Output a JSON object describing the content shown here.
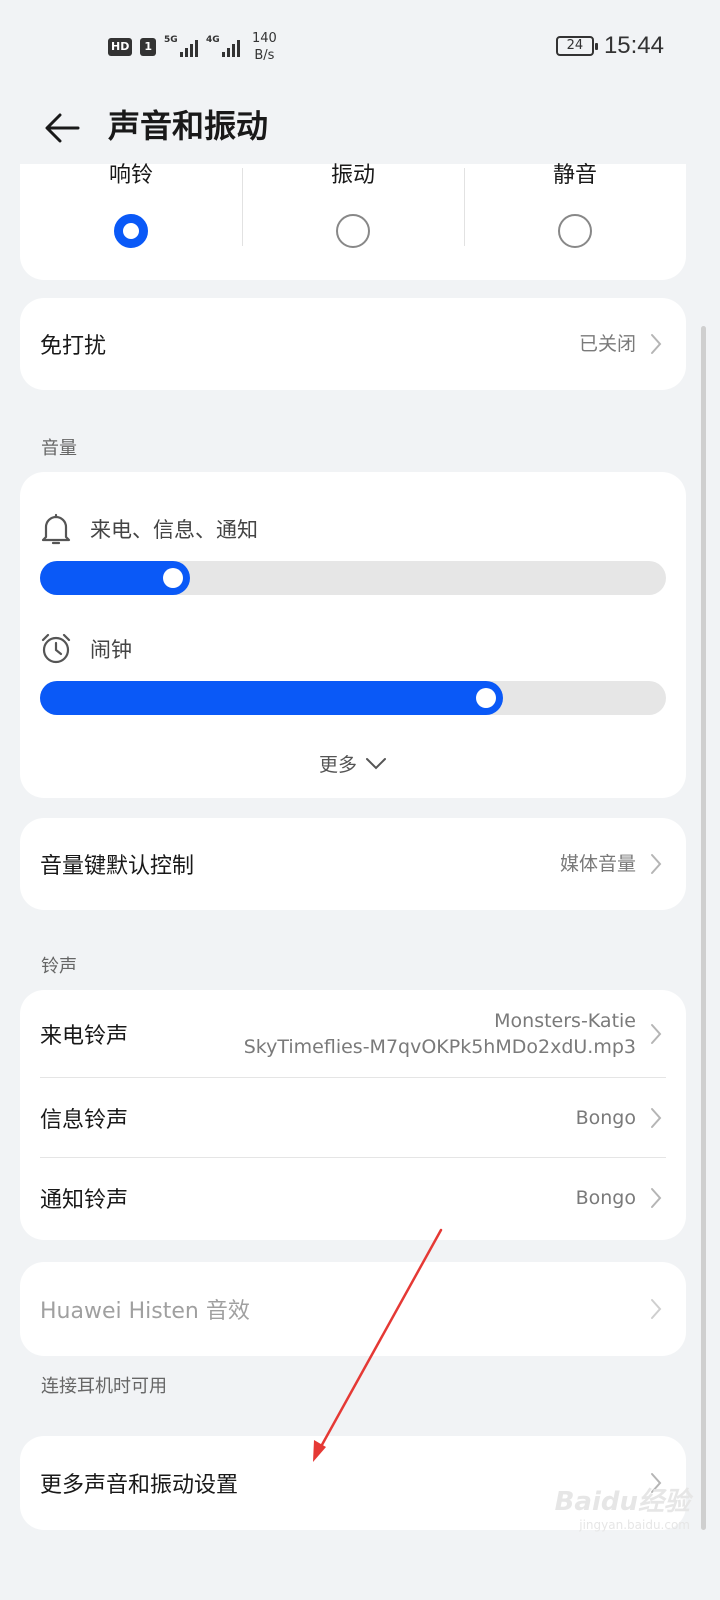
{
  "status_bar": {
    "hd": "HD",
    "sim": "1",
    "net1": "5G",
    "net2": "4G",
    "speed_value": "140",
    "speed_unit": "B/s",
    "battery": "24",
    "time": "15:44"
  },
  "header": {
    "title": "声音和振动"
  },
  "modes": [
    {
      "label": "响铃",
      "selected": true
    },
    {
      "label": "振动",
      "selected": false
    },
    {
      "label": "静音",
      "selected": false
    }
  ],
  "dnd": {
    "label": "免打扰",
    "value": "已关闭"
  },
  "volume": {
    "section_title": "音量",
    "ring": {
      "label": "来电、信息、通知",
      "level": 0.24
    },
    "alarm": {
      "label": "闹钟",
      "level": 0.74
    },
    "more": "更多"
  },
  "volume_key": {
    "label": "音量键默认控制",
    "value": "媒体音量"
  },
  "ringtones": {
    "section_title": "铃声",
    "items": [
      {
        "label": "来电铃声",
        "value_line1": "Monsters-Katie",
        "value_line2": "SkyTimeflies-M7qvOKPk5hMDo2xdU.mp3"
      },
      {
        "label": "信息铃声",
        "value": "Bongo"
      },
      {
        "label": "通知铃声",
        "value": "Bongo"
      }
    ]
  },
  "histen": {
    "label": "Huawei Histen 音效",
    "note": "连接耳机时可用"
  },
  "more_settings": {
    "label": "更多声音和振动设置"
  },
  "watermark": {
    "text": "Baidu经验",
    "sub": "jingyan.baidu.com"
  },
  "colors": {
    "accent": "#0a59f7",
    "background": "#f1f3f5",
    "arrow": "#e53935"
  }
}
